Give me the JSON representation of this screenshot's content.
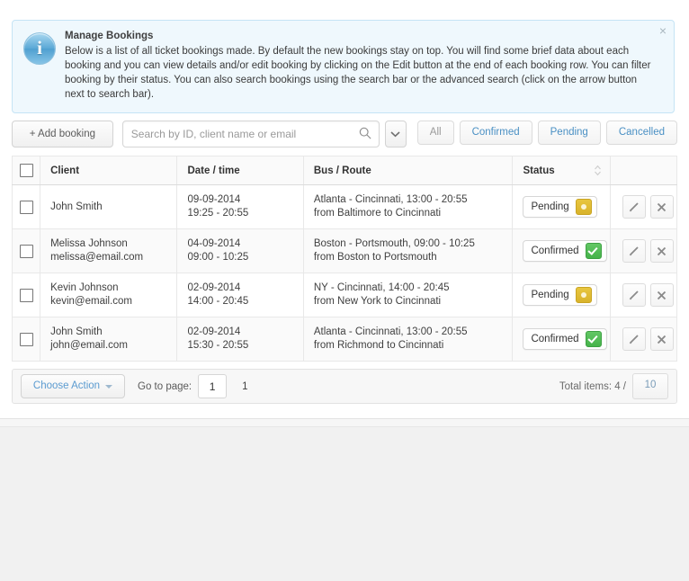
{
  "alert": {
    "icon": "info-circle-icon",
    "title": "Manage Bookings",
    "text": "Below is a list of all ticket bookings made. By default the new bookings stay on top. You will find some brief data about each booking and you can view details and/or edit booking by clicking on the Edit button at the end of each booking row. You can filter booking by their status. You can also search bookings using the search bar or the advanced search (click on the arrow button next to search bar).",
    "close_label": "×"
  },
  "toolbar": {
    "add_booking_label": "+ Add booking",
    "search_placeholder": "Search by ID, client name or email",
    "search_value": "",
    "search_icon": "search-icon",
    "advanced_toggle_icon": "chevron-down-icon",
    "filters": [
      {
        "label": "All",
        "active": true
      },
      {
        "label": "Confirmed",
        "active": false
      },
      {
        "label": "Pending",
        "active": false
      },
      {
        "label": "Cancelled",
        "active": false
      }
    ]
  },
  "table": {
    "columns": [
      "",
      "Client",
      "Date / time",
      "Bus / Route",
      "Status",
      ""
    ],
    "status_sort_icon": "sort-updown-icon",
    "rows": [
      {
        "client_name": "John Smith",
        "client_email": "",
        "date": "09-09-2014",
        "time": "19:25 - 20:55",
        "route_top": "Atlanta - Cincinnati, 13:00 - 20:55",
        "route_bottom": "from Baltimore to Cincinnati",
        "status": "Pending",
        "status_kind": "pending"
      },
      {
        "client_name": "Melissa Johnson",
        "client_email": "melissa@email.com",
        "date": "04-09-2014",
        "time": "09:00 - 10:25",
        "route_top": "Boston - Portsmouth, 09:00 - 10:25",
        "route_bottom": "from Boston to Portsmouth",
        "status": "Confirmed",
        "status_kind": "confirmed"
      },
      {
        "client_name": "Kevin Johnson",
        "client_email": "kevin@email.com",
        "date": "02-09-2014",
        "time": "14:00 - 20:45",
        "route_top": "NY - Cincinnati, 14:00 - 20:45",
        "route_bottom": "from New York to Cincinnati",
        "status": "Pending",
        "status_kind": "pending"
      },
      {
        "client_name": "John Smith",
        "client_email": "john@email.com",
        "date": "02-09-2014",
        "time": "15:30 - 20:55",
        "route_top": "Atlanta - Cincinnati, 13:00 - 20:55",
        "route_bottom": "from Richmond to Cincinnati",
        "status": "Confirmed",
        "status_kind": "confirmed"
      }
    ],
    "row_actions": {
      "edit_icon": "pencil-icon",
      "delete_icon": "close-x-icon"
    }
  },
  "footer": {
    "choose_action_label": "Choose Action",
    "goto_label": "Go to page:",
    "page_value": "1",
    "current_page": "1",
    "total_label": "Total items: 4 /",
    "per_page": "10"
  },
  "colors": {
    "accent": "#4a90c4",
    "pending": "#d9b32b",
    "confirmed": "#45b34a",
    "alert_bg": "#eff8fd",
    "alert_border": "#c5e4f5"
  }
}
